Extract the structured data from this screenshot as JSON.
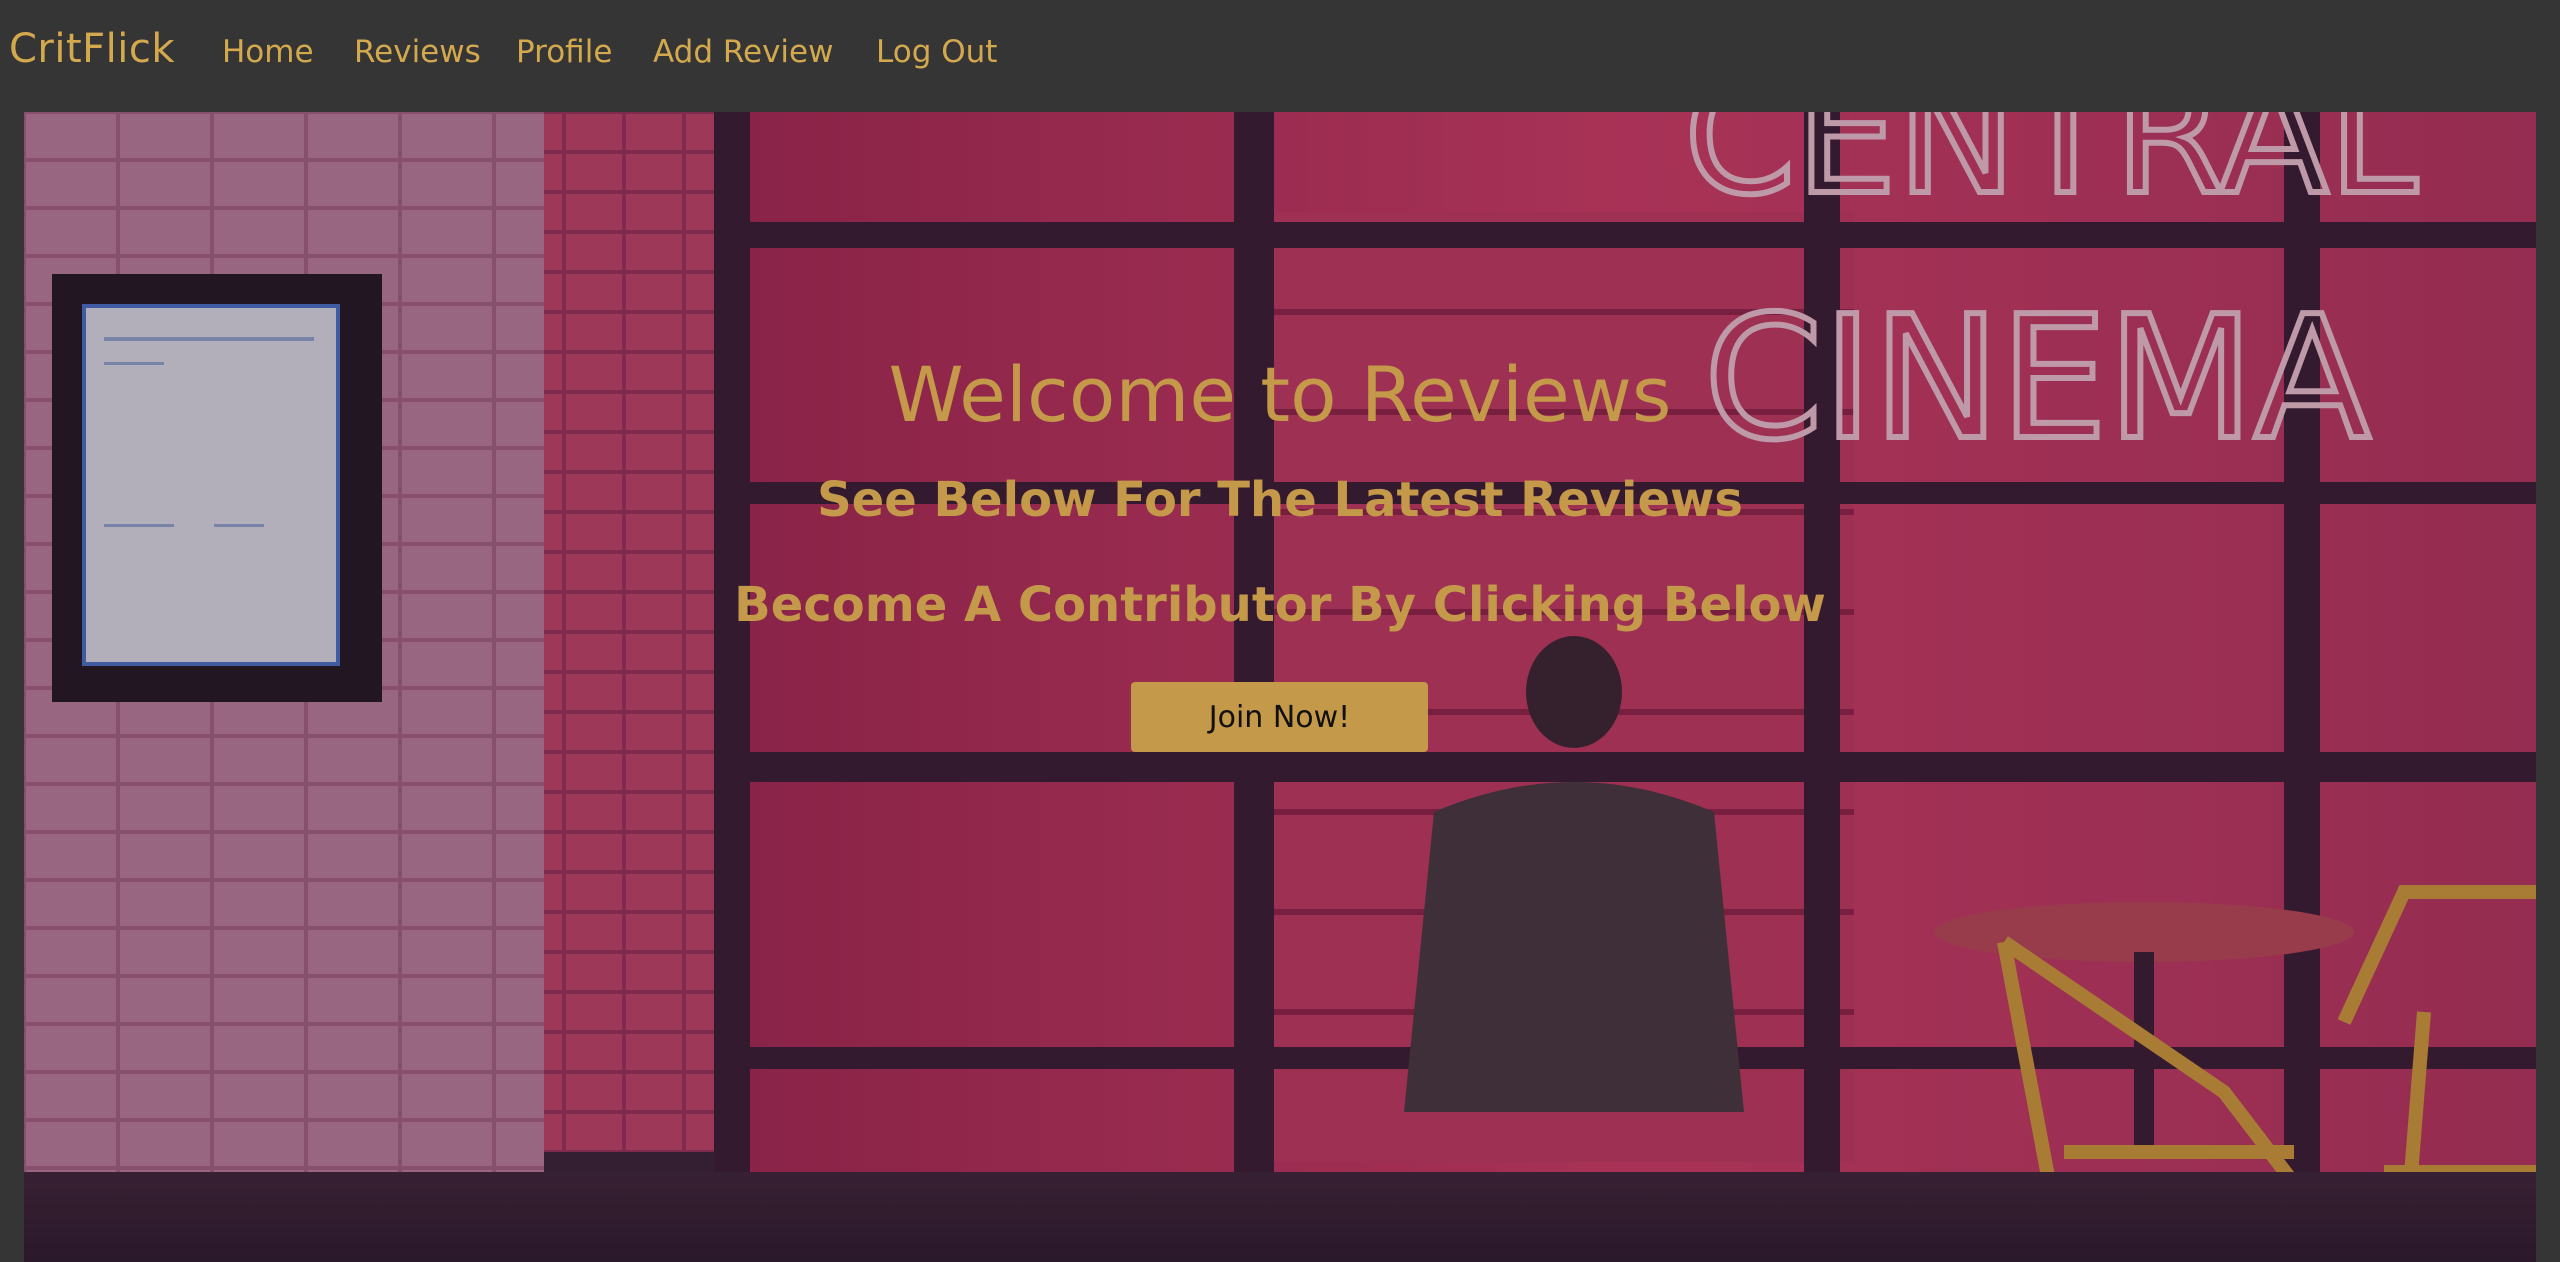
{
  "navbar": {
    "brand": "CritFlick",
    "links": [
      {
        "label": "Home"
      },
      {
        "label": "Reviews"
      },
      {
        "label": "Profile"
      },
      {
        "label": "Add Review"
      },
      {
        "label": "Log Out"
      }
    ]
  },
  "hero": {
    "title": "Welcome to Reviews",
    "subtitle": "See Below For The Latest Reviews",
    "cta_text": "Become A Contributor By Clicking Below",
    "button_label": "Join Now!",
    "background_sign_text": [
      "CENTRAL",
      "CINEMA"
    ]
  },
  "colors": {
    "accent": "#d4a94d",
    "nav_background": "#353535",
    "neon_pink": "#e03a6c"
  }
}
